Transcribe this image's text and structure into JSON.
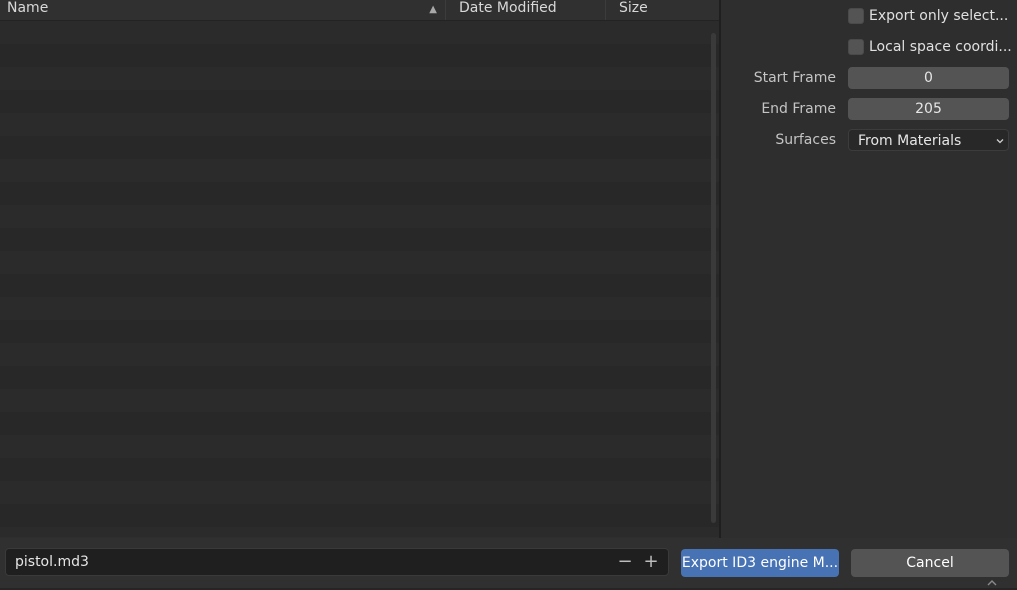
{
  "file_list": {
    "columns": [
      {
        "label": "Name"
      },
      {
        "label": "Date Modified"
      },
      {
        "label": "Size"
      }
    ],
    "sort_icon": "triangle-up-icon"
  },
  "options": {
    "export_only_selected": {
      "label": "Export only select...",
      "checked": false
    },
    "local_space": {
      "label": "Local space coordi...",
      "checked": false
    },
    "start_frame": {
      "label": "Start Frame",
      "value": "0"
    },
    "end_frame": {
      "label": "End Frame",
      "value": "205"
    },
    "surfaces": {
      "label": "Surfaces",
      "value": "From Materials"
    }
  },
  "footer": {
    "filename": "pistol.md3",
    "decrement_symbol": "−",
    "increment_symbol": "+",
    "export_label": "Export ID3 engine M...",
    "cancel_label": "Cancel"
  },
  "colors": {
    "accent": "#4772b3",
    "background": "#2e2e2e"
  }
}
